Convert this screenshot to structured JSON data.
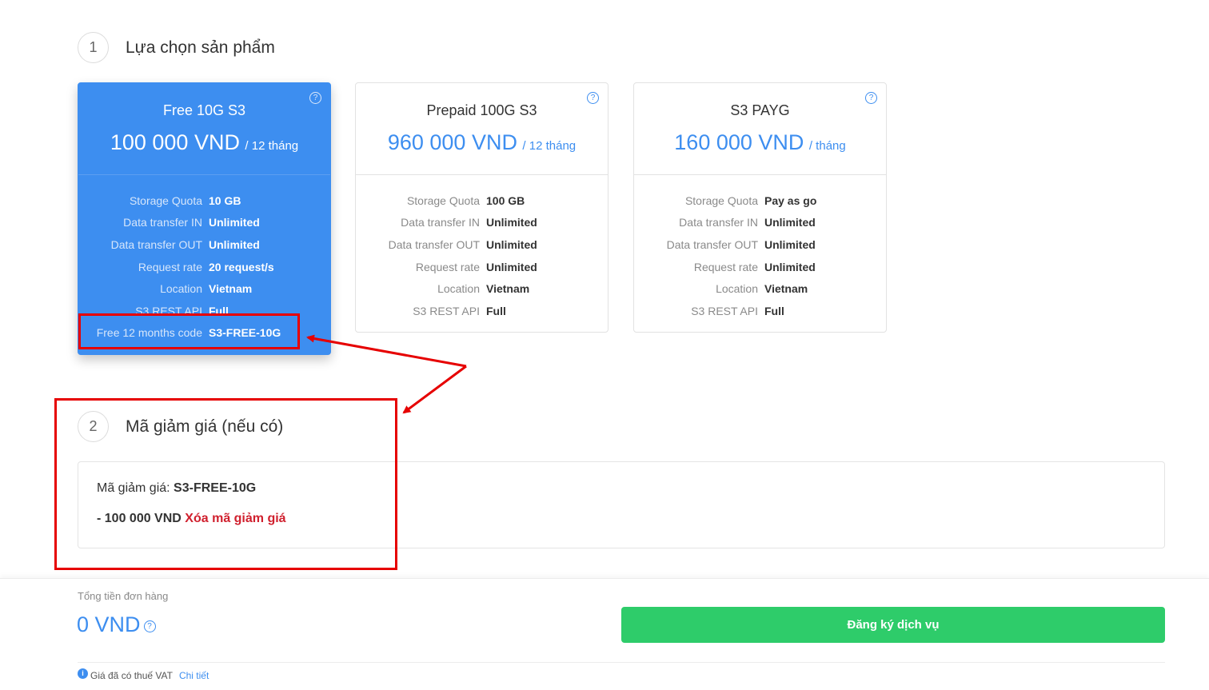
{
  "step1": {
    "number": "1",
    "title": "Lựa chọn sản phẩm"
  },
  "products": [
    {
      "name": "Free 10G S3",
      "price": "100 000 VND",
      "period": "/ 12 tháng",
      "selected": true,
      "specs": [
        {
          "label": "Storage Quota",
          "value": "10 GB"
        },
        {
          "label": "Data transfer IN",
          "value": "Unlimited"
        },
        {
          "label": "Data transfer OUT",
          "value": "Unlimited"
        },
        {
          "label": "Request rate",
          "value": "20 request/s"
        },
        {
          "label": "Location",
          "value": "Vietnam"
        },
        {
          "label": "S3 REST API",
          "value": "Full"
        },
        {
          "label": "Free 12 months code",
          "value": "S3-FREE-10G"
        }
      ]
    },
    {
      "name": "Prepaid 100G S3",
      "price": "960 000 VND",
      "period": "/ 12 tháng",
      "selected": false,
      "specs": [
        {
          "label": "Storage Quota",
          "value": "100 GB"
        },
        {
          "label": "Data transfer IN",
          "value": "Unlimited"
        },
        {
          "label": "Data transfer OUT",
          "value": "Unlimited"
        },
        {
          "label": "Request rate",
          "value": "Unlimited"
        },
        {
          "label": "Location",
          "value": "Vietnam"
        },
        {
          "label": "S3 REST API",
          "value": "Full"
        }
      ]
    },
    {
      "name": "S3 PAYG",
      "price": "160 000 VND",
      "period": "/ tháng",
      "selected": false,
      "specs": [
        {
          "label": "Storage Quota",
          "value": "Pay as go"
        },
        {
          "label": "Data transfer IN",
          "value": "Unlimited"
        },
        {
          "label": "Data transfer OUT",
          "value": "Unlimited"
        },
        {
          "label": "Request rate",
          "value": "Unlimited"
        },
        {
          "label": "Location",
          "value": "Vietnam"
        },
        {
          "label": "S3 REST API",
          "value": "Full"
        }
      ]
    }
  ],
  "step2": {
    "number": "2",
    "title": "Mã giảm giá (nếu có)"
  },
  "discount": {
    "code_label": "Mã giảm giá:",
    "code": "S3-FREE-10G",
    "amount": "- 100 000 VND",
    "remove_label": "Xóa mã giảm giá"
  },
  "summary": {
    "total_label": "Tổng tiền đơn hàng",
    "total_value": "0 VND",
    "register_label": "Đăng ký dịch vụ",
    "vat_note": "Giá đã có thuế VAT",
    "vat_link": "Chi tiết"
  },
  "icons": {
    "help": "help-circle-icon",
    "info": "info-icon"
  },
  "colors": {
    "primary": "#3d8ef0",
    "success": "#2ecc6a",
    "danger": "#d0202e",
    "annotation": "#e60000"
  }
}
